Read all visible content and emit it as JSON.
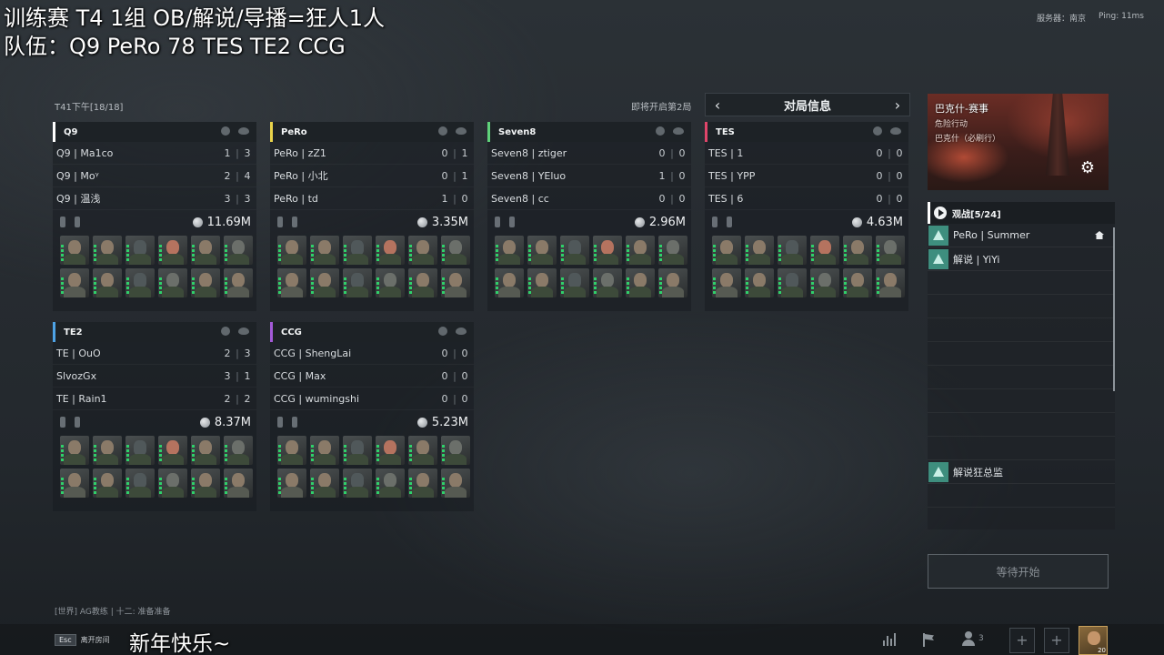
{
  "overlay": {
    "line1": "训练赛 T4 1组 OB/解说/导播=狂人1人",
    "line2": "队伍：Q9 PeRo 78 TES TE2 CCG",
    "bottom_text": "新年快乐~"
  },
  "server": {
    "label": "服务器：南京",
    "ping": "Ping: 11ms"
  },
  "lobby": {
    "name": "T41下午[18/18]",
    "next_round": "即将开启第2局"
  },
  "match_nav": {
    "title": "对局信息",
    "prev": "‹",
    "next": "›"
  },
  "teams": [
    {
      "name": "Q9",
      "color": "#ffffff",
      "money": "11.69M",
      "players": [
        {
          "name": "Q9 | Ma1co",
          "k": "1",
          "d": "3"
        },
        {
          "name": "Q9 | Moᵞ",
          "k": "2",
          "d": "4"
        },
        {
          "name": "Q9 | 温浅",
          "k": "3",
          "d": "3"
        }
      ]
    },
    {
      "name": "PeRo",
      "color": "#e8d24a",
      "money": "3.35M",
      "players": [
        {
          "name": "PeRo | zZ1",
          "k": "0",
          "d": "1"
        },
        {
          "name": "PeRo | 小北",
          "k": "0",
          "d": "1"
        },
        {
          "name": "PeRo | td",
          "k": "1",
          "d": "0"
        }
      ]
    },
    {
      "name": "Seven8",
      "color": "#5fd27a",
      "money": "2.96M",
      "players": [
        {
          "name": "Seven8 | ztiger",
          "k": "0",
          "d": "0"
        },
        {
          "name": "Seven8 | YEluo",
          "k": "1",
          "d": "0"
        },
        {
          "name": "Seven8 | cc",
          "k": "0",
          "d": "0"
        }
      ]
    },
    {
      "name": "TES",
      "color": "#e0456a",
      "money": "4.63M",
      "players": [
        {
          "name": "TES | 1",
          "k": "0",
          "d": "0"
        },
        {
          "name": "TES | YPP",
          "k": "0",
          "d": "0"
        },
        {
          "name": "TES | 6",
          "k": "0",
          "d": "0"
        }
      ]
    },
    {
      "name": "TE2",
      "color": "#4ea3e6",
      "money": "8.37M",
      "players": [
        {
          "name": "TE | OuO",
          "k": "2",
          "d": "3"
        },
        {
          "name": "SlvozGx",
          "k": "3",
          "d": "1"
        },
        {
          "name": "TE | Rain1",
          "k": "2",
          "d": "2"
        }
      ]
    },
    {
      "name": "CCG",
      "color": "#a35ad8",
      "money": "5.23M",
      "players": [
        {
          "name": "CCG | ShengLai",
          "k": "0",
          "d": "0"
        },
        {
          "name": "CCG | Max",
          "k": "0",
          "d": "0"
        },
        {
          "name": "CCG | wumingshi",
          "k": "0",
          "d": "0"
        }
      ]
    }
  ],
  "map": {
    "title": "巴克什-赛事",
    "mode": "危险行动",
    "sub": "巴克什（必刷行）",
    "settings_icon": "gear-icon"
  },
  "spectators": {
    "title": "观战[5/24]",
    "list": [
      "PeRo | Summer",
      "解说 | YiYi",
      "解说狂总监"
    ]
  },
  "wait_button": "等待开始",
  "chat": "[世界] AG教练 | 十二: 准备准备",
  "footer": {
    "esc_key": "Esc",
    "esc_label": "离开房间",
    "party_count": "3",
    "add": "+",
    "avatar_level": "20"
  }
}
